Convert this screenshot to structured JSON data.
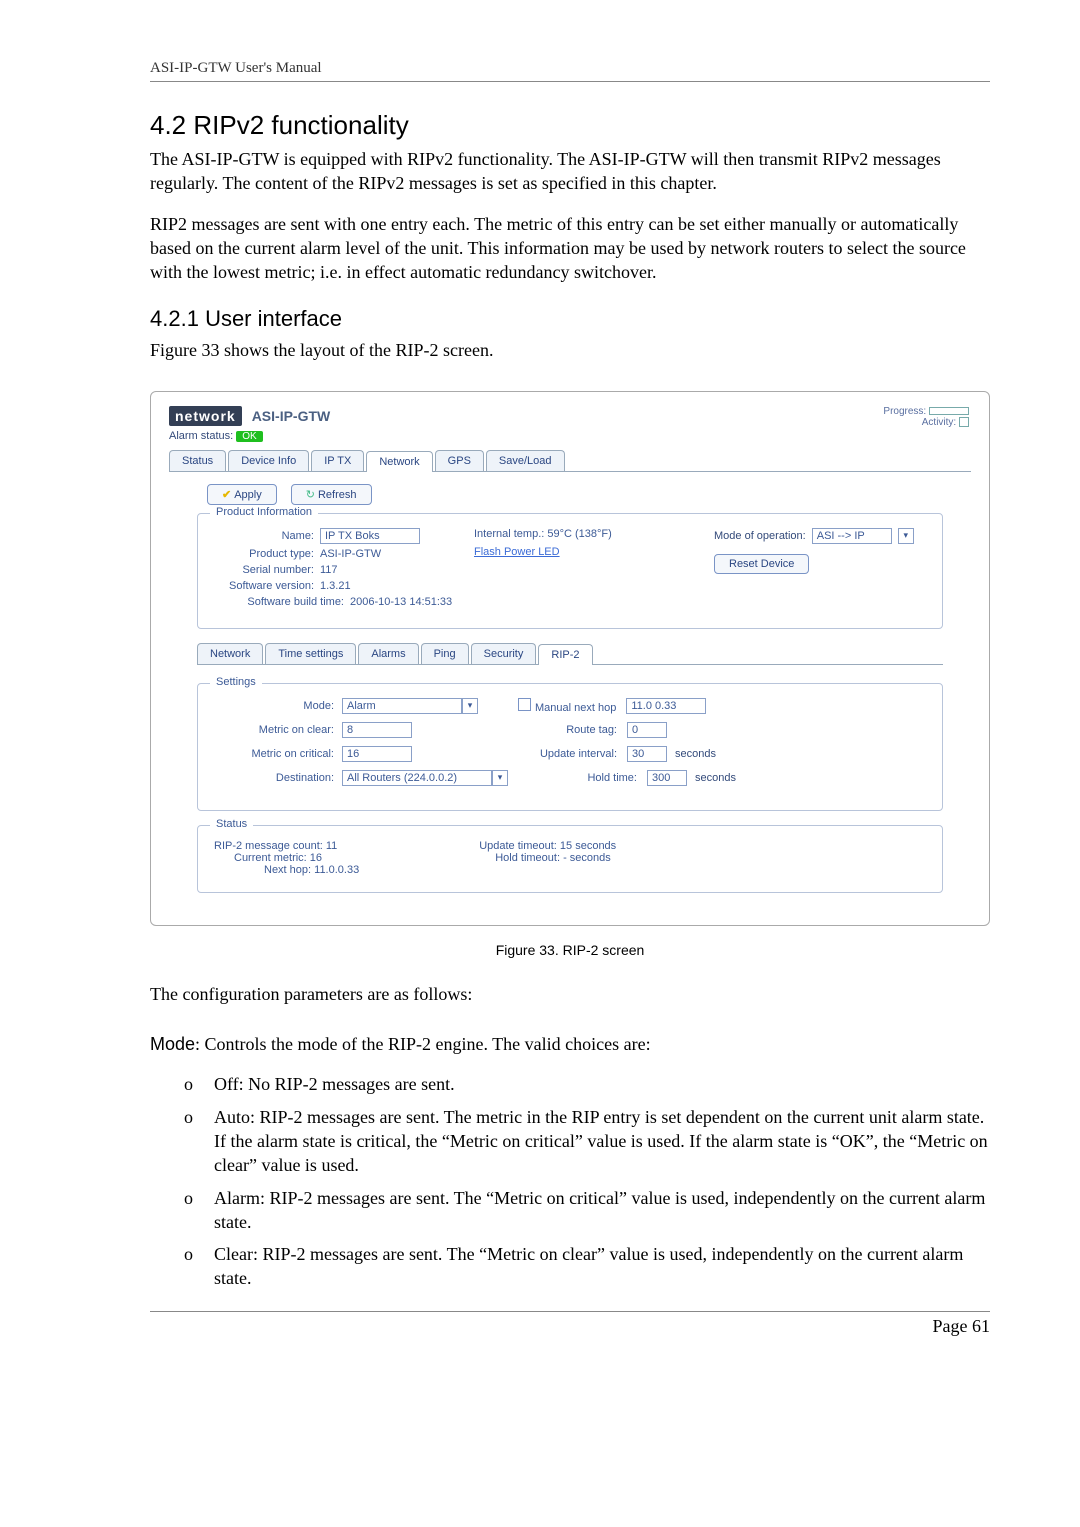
{
  "running_header": "ASI-IP-GTW User's Manual",
  "section_number": "4.2",
  "section_title": "RIPv2 functionality",
  "para1": "The ASI-IP-GTW is equipped with RIPv2 functionality. The ASI-IP-GTW will then transmit RIPv2 messages regularly. The content of the RIPv2 messages is set as specified in this chapter.",
  "para2": "RIP2 messages are sent with one entry each. The metric of this entry can be set either manually or automatically based on the current alarm level of the unit. This information may be used by network routers to select the source with the lowest metric; i.e. in effect automatic redundancy switchover.",
  "subsection_number": "4.2.1",
  "subsection_title": "User interface",
  "para3": "Figure 33 shows the layout of the RIP-2 screen.",
  "screenshot": {
    "logo_word": "network",
    "logo_model": "ASI-IP-GTW",
    "progress_label": "Progress:",
    "activity_label": "Activity:",
    "alarm_status_label": "Alarm status:",
    "alarm_status_value": "OK",
    "tabs_main": [
      "Status",
      "Device Info",
      "IP TX",
      "Network",
      "GPS",
      "Save/Load"
    ],
    "tabs_main_active": 3,
    "apply_btn": "Apply",
    "refresh_btn": "Refresh",
    "product_info_legend": "Product Information",
    "pi_name_label": "Name:",
    "pi_name_value": "IP TX Boks",
    "pi_ptype_label": "Product type:",
    "pi_ptype_value": "ASI-IP-GTW",
    "pi_serial_label": "Serial number:",
    "pi_serial_value": "117",
    "pi_swver_label": "Software version:",
    "pi_swver_value": "1.3.21",
    "pi_build_label": "Software build time:",
    "pi_build_value": "2006-10-13 14:51:33",
    "pi_intemp": "Internal temp.: 59°C (138°F)",
    "pi_flash": "Flash Power LED",
    "pi_moo_label": "Mode of operation:",
    "pi_moo_value": "ASI --> IP",
    "reset_btn": "Reset Device",
    "tabs_inner": [
      "Network",
      "Time settings",
      "Alarms",
      "Ping",
      "Security",
      "RIP-2"
    ],
    "tabs_inner_active": 5,
    "settings_legend": "Settings",
    "mode_label": "Mode:",
    "mode_value": "Alarm",
    "manual_next_hop_label": "Manual next hop",
    "manual_next_hop_value": "11.0 0.33",
    "metric_clear_label": "Metric on clear:",
    "metric_clear_value": "8",
    "route_tag_label": "Route tag:",
    "route_tag_value": "0",
    "metric_critical_label": "Metric on critical:",
    "metric_critical_value": "16",
    "update_interval_label": "Update interval:",
    "update_interval_value": "30",
    "seconds": "seconds",
    "destination_label": "Destination:",
    "destination_value": "All Routers (224.0.0.2)",
    "hold_time_label": "Hold time:",
    "hold_time_value": "300",
    "status_legend": "Status",
    "status_left_1": "RIP-2 message count: 11",
    "status_left_2": "Current metric: 16",
    "status_left_3": "Next hop: 11.0.0.33",
    "status_right_1": "Update timeout: 15 seconds",
    "status_right_2": "Hold timeout: - seconds"
  },
  "figure_caption": "Figure 33. RIP-2 screen",
  "para4": "The configuration parameters are as follows:",
  "mode_para_label": "Mode",
  "mode_para_text": ": Controls the mode of the RIP-2 engine. The valid choices are:",
  "bullets": [
    "Off: No RIP-2 messages are sent.",
    "Auto: RIP-2 messages are sent. The metric in the RIP entry is set dependent on the current unit alarm state. If the alarm state is critical, the “Metric on critical” value is used. If the alarm state is “OK”, the “Metric on clear” value is used.",
    "Alarm: RIP-2 messages are sent. The “Metric on critical” value is used, independently on the current alarm state.",
    "Clear: RIP-2 messages are sent. The “Metric on clear” value is used, independently on the current alarm state."
  ],
  "page_number": "Page 61"
}
